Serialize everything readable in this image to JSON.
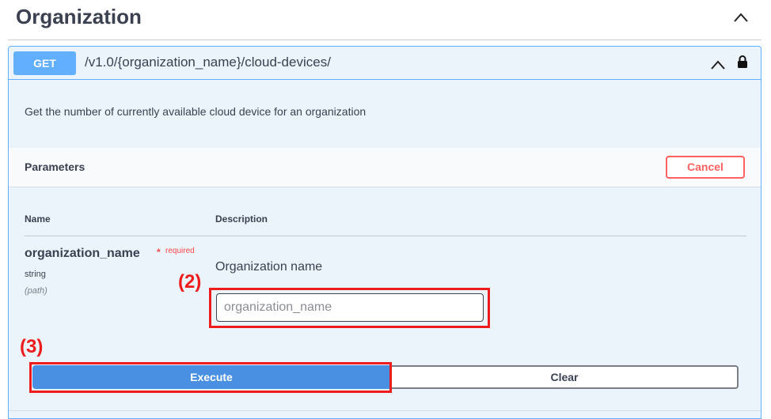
{
  "section": {
    "title": "Organization"
  },
  "operation": {
    "method": "GET",
    "path": "/v1.0/{organization_name}/cloud-devices/",
    "description": "Get the number of currently available cloud device for an organization"
  },
  "parameters": {
    "title": "Parameters",
    "cancel_label": "Cancel",
    "columns": {
      "name": "Name",
      "description": "Description"
    },
    "items": [
      {
        "name": "organization_name",
        "required_star": "*",
        "required_label": "required",
        "type": "string",
        "in": "(path)",
        "description": "Organization name",
        "placeholder": "organization_name"
      }
    ]
  },
  "actions": {
    "execute_label": "Execute",
    "clear_label": "Clear"
  },
  "annotations": {
    "step2": "(2)",
    "step3": "(3)"
  },
  "icons": {
    "section_toggle": "chevron-up-icon",
    "op_toggle": "chevron-up-icon",
    "auth": "lock-icon"
  },
  "colors": {
    "accent": "#61affe",
    "execute": "#4990e2",
    "cancel": "#ff6060",
    "annotation": "#ee1c1c"
  }
}
